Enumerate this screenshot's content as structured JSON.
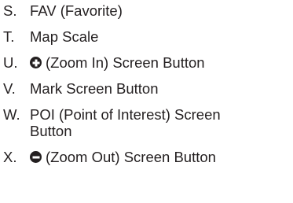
{
  "legend": {
    "items": [
      {
        "letter": "S.",
        "text": "FAV (Favorite)"
      },
      {
        "letter": "T.",
        "text": "Map Scale"
      },
      {
        "letter": "U.",
        "icon": "zoom-in-circle-plus-icon",
        "text": "(Zoom In) Screen Button"
      },
      {
        "letter": "V.",
        "text": "Mark Screen Button"
      },
      {
        "letter": "W.",
        "text": "POI (Point of Interest) Screen",
        "text_line2": "Button"
      },
      {
        "letter": "X.",
        "icon": "zoom-out-circle-minus-icon",
        "text": "(Zoom Out) Screen Button"
      }
    ]
  }
}
